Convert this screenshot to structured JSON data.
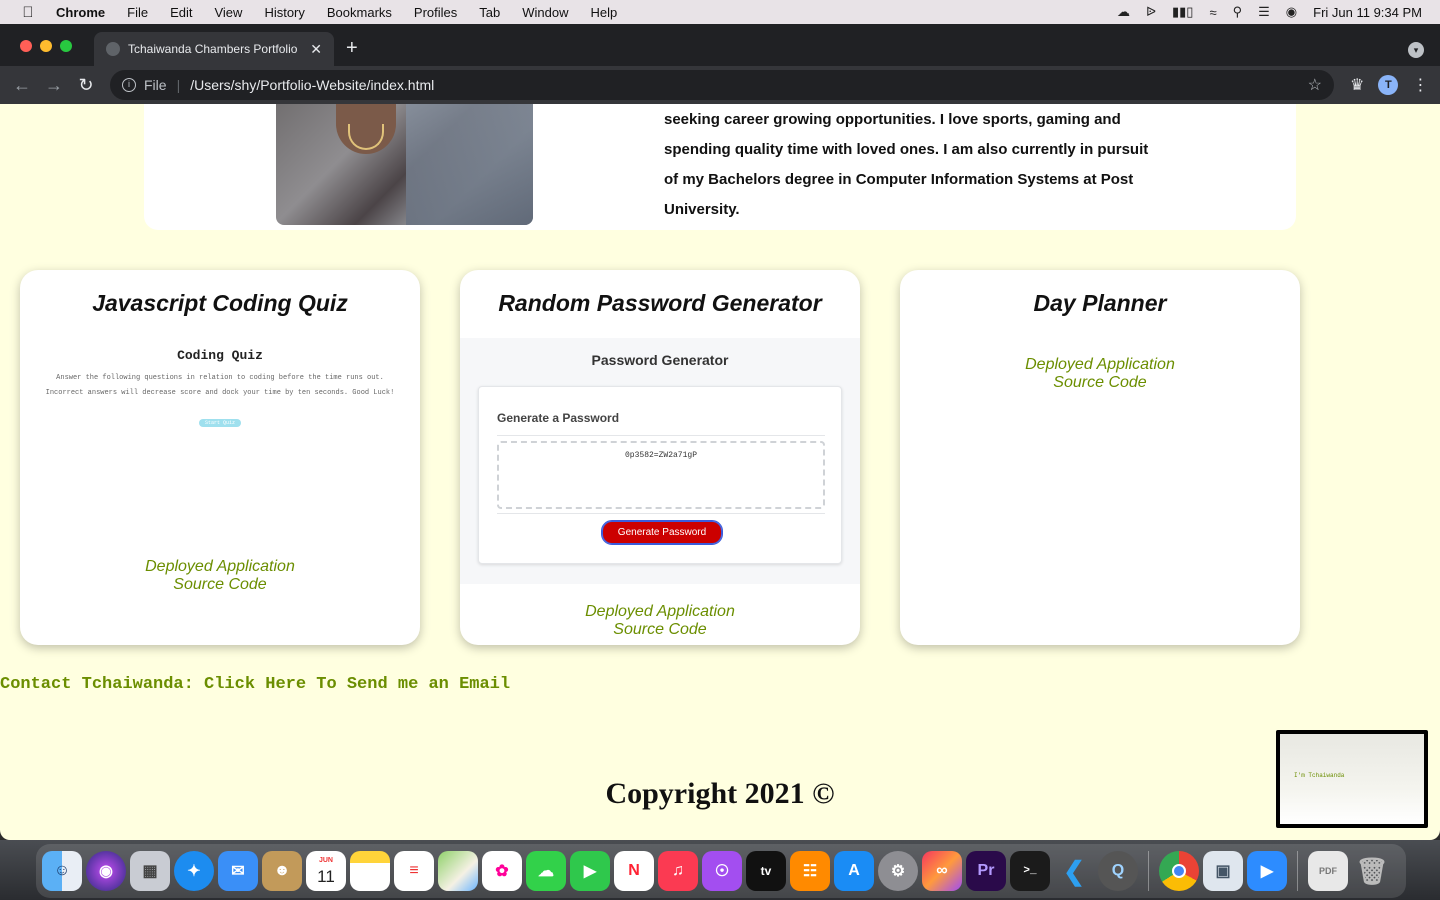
{
  "menubar": {
    "app_name": "Chrome",
    "items": [
      "File",
      "Edit",
      "View",
      "History",
      "Bookmarks",
      "Profiles",
      "Tab",
      "Window",
      "Help"
    ],
    "clock": "Fri Jun 11  9:34 PM"
  },
  "browser": {
    "tab_title": "Tchaiwanda Chambers Portfolio",
    "url_scheme": "File",
    "url_path": "/Users/shy/Portfolio-Website/index.html",
    "profile_initial": "T"
  },
  "about": {
    "lines": [
      "seeking career growing opportunities. I love sports, gaming and",
      "spending quality time with loved ones. I am also currently in pursuit",
      "of my Bachelors degree in Computer Information Systems at Post",
      "University."
    ]
  },
  "projects": [
    {
      "title": "Javascript Coding Quiz",
      "preview": {
        "heading": "Coding Quiz",
        "desc1": "Answer the following questions in relation to coding before the time runs out.",
        "desc2": "Incorrect answers will decrease score and dock your time by ten seconds. Good Luck!",
        "button": "Start Quiz"
      },
      "deployed": "Deployed Application",
      "source": "Source Code"
    },
    {
      "title": "Random Password Generator",
      "preview": {
        "heading": "Password Generator",
        "subheading": "Generate a Password",
        "password": "0p3582=ZW2a71gP",
        "button": "Generate Password"
      },
      "deployed": "Deployed Application",
      "source": "Source Code"
    },
    {
      "title": "Day Planner",
      "deployed": "Deployed Application",
      "source": "Source Code"
    }
  ],
  "contact": "Contact Tchaiwanda: Click Here To Send me an Email",
  "copyright": "Copyright 2021 ©",
  "thumbnail_text": "I'm Tchaiwanda",
  "dock": {
    "calendar_month": "JUN",
    "calendar_day": "11",
    "apps": [
      "finder",
      "siri",
      "launchpad",
      "safari",
      "mail",
      "contacts",
      "calendar",
      "notes",
      "reminders",
      "maps",
      "photos",
      "messages",
      "facetime",
      "news",
      "music",
      "podcasts",
      "tv",
      "books",
      "app-store",
      "system-preferences",
      "creative-cloud",
      "premiere-pro",
      "terminal",
      "vscode",
      "quicktime",
      "chrome",
      "preview",
      "zoom",
      "documents",
      "trash"
    ]
  },
  "colors": {
    "page_bg": "#ffffe0",
    "link_green": "#6b8e00",
    "generate_red": "#cc0000"
  }
}
